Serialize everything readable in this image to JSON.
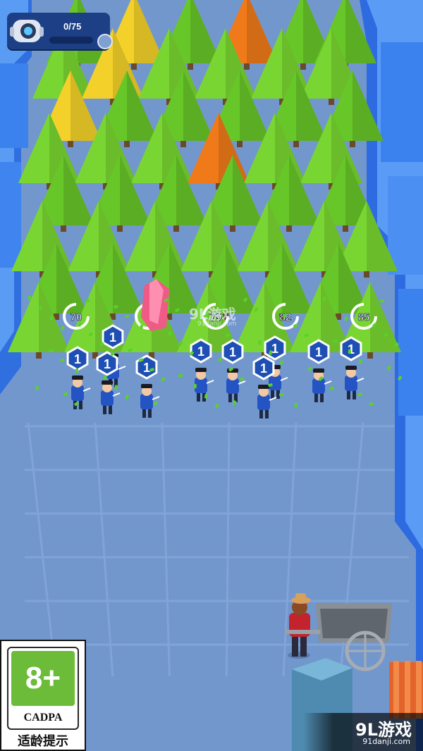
{
  "hud": {
    "progress_text": "0/75",
    "progress_fraction": 0,
    "icon": "robot-head-icon",
    "badge_icon": "shield-badge-icon"
  },
  "tree_health": [
    "70",
    "79",
    "79",
    "82",
    "85"
  ],
  "units": [
    {
      "level": "1"
    },
    {
      "level": "1"
    },
    {
      "level": "1"
    },
    {
      "level": "1"
    },
    {
      "level": "1"
    },
    {
      "level": "1"
    },
    {
      "level": "1"
    },
    {
      "level": "1"
    },
    {
      "level": "1"
    },
    {
      "level": "1"
    }
  ],
  "rating_badge": {
    "age": "8+",
    "org": "CADPA",
    "tip": "适龄提示"
  },
  "watermark": {
    "logo": "9L游戏",
    "url": "91danji.com",
    "center_logo": "9L游戏",
    "center_url": "91danji.com"
  },
  "colors": {
    "ground": "#7297cc",
    "wall": "#3f7ee8",
    "tree_green": "#6fcf2a",
    "tree_yellow": "#f4d12a",
    "tree_orange": "#f07a1a",
    "unit_badge": "#1e4fb4",
    "hud_bg": "#1d3f86"
  }
}
